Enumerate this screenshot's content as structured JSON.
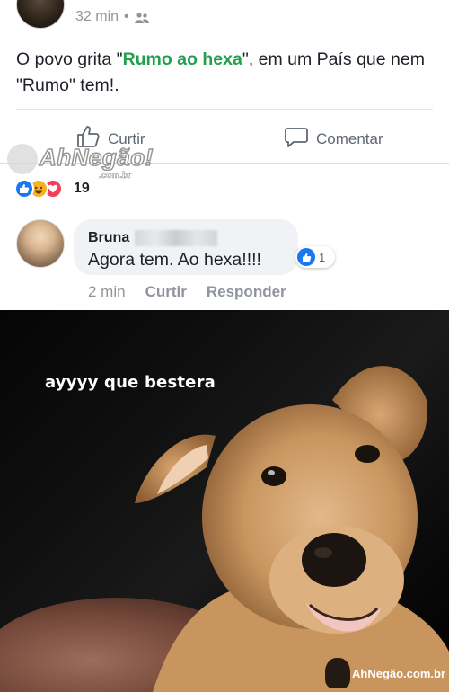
{
  "post": {
    "time": "32 min",
    "separator": "•",
    "text_before": "O povo grita \"",
    "text_highlight": "Rumo ao hexa",
    "text_after": "\", em um País que nem \"Rumo\" tem!.",
    "actions": {
      "like_label": "Curtir",
      "comment_label": "Comentar"
    },
    "reaction_count": "19"
  },
  "watermark": {
    "text": "AhNegão!",
    "sub": ".com.br"
  },
  "comment": {
    "author": "Bruna",
    "text": "Agora tem. Ao hexa!!!!",
    "like_count": "1",
    "time": "2 min",
    "like_label": "Curtir",
    "reply_label": "Responder"
  },
  "meme": {
    "caption": "ayyyy que bestera",
    "logo_text": "AhNegão.com.br"
  },
  "colors": {
    "highlight": "#22a04f",
    "like_blue": "#1877f2",
    "haha_yellow": "#f7b125",
    "love_red": "#f33e58",
    "muted": "#90949c"
  },
  "icons": [
    "friends-icon",
    "thumbs-up-icon",
    "comment-bubble-icon",
    "like-reaction-icon",
    "haha-reaction-icon",
    "love-reaction-icon"
  ]
}
